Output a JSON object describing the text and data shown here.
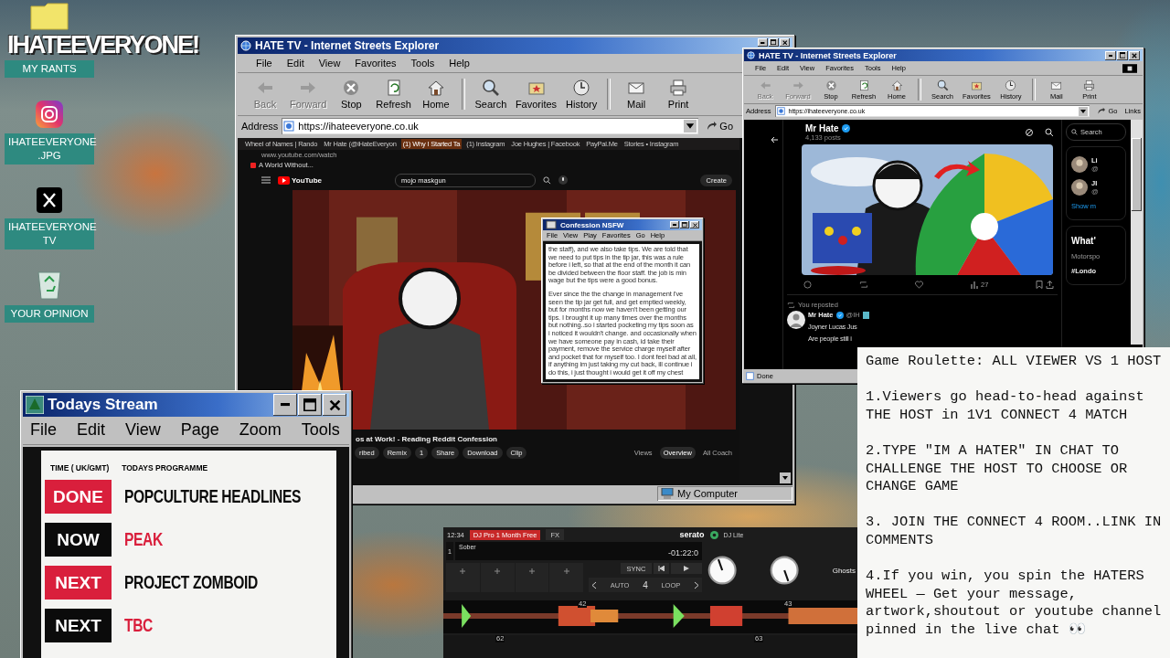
{
  "desktop": {
    "logo": "IHATEEVERYONE!",
    "icons": [
      {
        "kind": "folder",
        "label": "MY RANTS"
      },
      {
        "kind": "instagram",
        "label": "IHATEEVERYONE .JPG"
      },
      {
        "kind": "x",
        "label": "IHATEEVERYONE TV"
      },
      {
        "kind": "recycle",
        "label": "YOUR OPINION"
      }
    ]
  },
  "browser": {
    "title": "HATE TV - Internet Streets Explorer",
    "menu": [
      "File",
      "Edit",
      "View",
      "Favorites",
      "Tools",
      "Help"
    ],
    "toolbar": [
      {
        "kind": "back",
        "label": "Back",
        "disabled": true
      },
      {
        "kind": "forward",
        "label": "Forward",
        "disabled": true
      },
      {
        "kind": "stop",
        "label": "Stop",
        "disabled": false
      },
      {
        "kind": "refresh",
        "label": "Refresh",
        "disabled": false
      },
      {
        "kind": "home",
        "label": "Home",
        "disabled": false
      },
      {
        "kind": "search",
        "label": "Search",
        "disabled": false
      },
      {
        "kind": "favorites",
        "label": "Favorites",
        "disabled": false
      },
      {
        "kind": "history",
        "label": "History",
        "disabled": false
      },
      {
        "kind": "mail",
        "label": "Mail",
        "disabled": false
      },
      {
        "kind": "print",
        "label": "Print",
        "disabled": false
      }
    ],
    "address_label": "Address",
    "address": "https://ihateeveryone.co.uk",
    "go": "Go",
    "page": {
      "tabs": [
        {
          "label": "Wheel of Names | Rando",
          "selected": false
        },
        {
          "label": "Mr Hate (@iHateEveryon",
          "selected": false
        },
        {
          "label": "(1) Why I Started Ta",
          "selected": true
        },
        {
          "label": "(1) Instagram",
          "selected": false
        },
        {
          "label": "Joe Hughes | Facebook",
          "selected": false
        },
        {
          "label": "PayPal.Me",
          "selected": false
        },
        {
          "label": "Stories • Instagram",
          "selected": false
        }
      ],
      "url": "www.youtube.com/watch",
      "bookmark": "A World Without...",
      "logo": "YouTube",
      "search": "mojo maskgun",
      "create": "Create",
      "video_title": "os at Work! - Reading Reddit Confession",
      "subscribe": "ribed",
      "actions": [
        "Remix",
        "1",
        "Share",
        "Download",
        "Clip"
      ],
      "panel_tabs": [
        {
          "label": "Views",
          "selected": false
        },
        {
          "label": "Overview",
          "selected": true
        },
        {
          "label": "All Coach",
          "selected": false
        }
      ]
    },
    "status": "My Computer"
  },
  "confession": {
    "title": "Confession NSFW",
    "menu": [
      "File",
      "View",
      "Play",
      "Favorites",
      "Go",
      "Help"
    ],
    "paragraphs": [
      "the staff), and we also take tips. We are told that we need to put tips in the tip jar, this was a rule before i left, so that at the end of the month it can be divided between the floor staff. the job is min wage but the tips were a good bonus.",
      "Ever since the the change in management i've seen the tip jar get full, and get emptied weekly, but for months now we haven't been getting our tips. I brought it up many times over the months but nothing..so i started pocketing my tips soon as i noticed it wouldn't change. and occasionally when we have someone pay in cash, id take their payment, remove the service charge myself after and pocket that for myself too. I dont feel bad at all, if anything im just taking my cut back, ill continue i do this, i just thought i would get it off my chest"
    ]
  },
  "browser_2": {
    "title": "HATE TV - Internet Streets Explorer",
    "menu": [
      "File",
      "Edit",
      "View",
      "Favorites",
      "Tools",
      "Help"
    ],
    "toolbar": [
      {
        "kind": "back",
        "label": "Back",
        "disabled": true
      },
      {
        "kind": "forward",
        "label": "Forward",
        "disabled": true
      },
      {
        "kind": "stop",
        "label": "Stop",
        "disabled": false
      },
      {
        "kind": "refresh",
        "label": "Refresh",
        "disabled": false
      },
      {
        "kind": "home",
        "label": "Home",
        "disabled": false
      },
      {
        "kind": "search",
        "label": "Search",
        "disabled": false
      },
      {
        "kind": "favorites",
        "label": "Favorites",
        "disabled": false
      },
      {
        "kind": "history",
        "label": "History",
        "disabled": false
      },
      {
        "kind": "mail",
        "label": "Mail",
        "disabled": false
      },
      {
        "kind": "print",
        "label": "Print",
        "disabled": false
      }
    ],
    "address_label": "Address",
    "address": "https://ihateeveryone.co.uk",
    "go": "Go",
    "links": "Links",
    "profile": {
      "name": "Mr Hate",
      "posts": "4,133 posts",
      "views": "27"
    },
    "repost": {
      "label": "You reposted",
      "name": "Mr Hate",
      "handle": "@IH",
      "lines": [
        "Joyner Lucas Jus",
        "Are people still i"
      ]
    },
    "sidebar": {
      "search": "Search",
      "accounts": [
        {
          "name": "Li",
          "handle": "@"
        },
        {
          "name": "JI",
          "handle": "@"
        }
      ],
      "show_more": "Show m",
      "trends_title": "What'",
      "trend_category": "Motorspo",
      "trend": "#Londo"
    },
    "status": "Done"
  },
  "schedule": {
    "title": "Todays Stream",
    "menu": [
      "File",
      "Edit",
      "View",
      "Page",
      "Zoom",
      "Tools"
    ],
    "headers": [
      "TIME ( UK/GMT)",
      "TODAYS PROGRAMME"
    ],
    "rows": [
      {
        "status": "DONE",
        "programme": "POPCULTURE HEADLINES",
        "color": "#d91f3c"
      },
      {
        "status": "NOW",
        "programme": "PEAK",
        "color": "#0b0b0b"
      },
      {
        "status": "NEXT",
        "programme": "PROJECT ZOMBOID",
        "color": "#d91f3c"
      },
      {
        "status": "NEXT",
        "programme": "TBC",
        "color": "#0b0b0b"
      }
    ]
  },
  "rules": {
    "heading": "Game Roulette: ALL VIEWER VS 1 HOST",
    "items": [
      "1.Viewers go head-to-head against THE HOST in 1V1 CONNECT 4 MATCH",
      "2.TYPE \"IM A HATER\" IN CHAT TO CHALLENGE THE HOST TO CHOOSE OR CHANGE GAME",
      "3. JOIN THE CONNECT 4 ROOM..LINK IN COMMENTS",
      "4.If you win, you spin the HATERS WHEEL — Get your message, artwork,shoutout or youtube channel pinned in the live chat 👀"
    ]
  },
  "dj": {
    "clock": "12:34",
    "promo": "DJ Pro 1 Month Free",
    "fx": "FX",
    "brand": "serato",
    "edition": "DJ Lite",
    "deck": "1",
    "track": "Sober",
    "time": "-01:22:0",
    "sync": "SYNC",
    "auto": "AUTO",
    "loop_size": "4",
    "loop": "LOOP",
    "track_2": "Ghosts",
    "beat_markers": [
      "42",
      "43"
    ],
    "beat_markers_2": [
      "62",
      "63"
    ]
  }
}
